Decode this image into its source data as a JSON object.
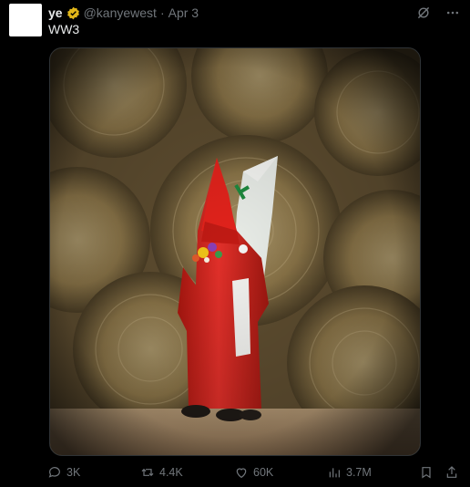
{
  "tweet": {
    "name": "ye",
    "handle": "@kanyewest",
    "separator": "·",
    "date": "Apr 3",
    "text": "WW3"
  },
  "actions": {
    "replies": "3K",
    "retweets": "4.4K",
    "likes": "60K",
    "views": "3.7M"
  },
  "icons": {
    "verified": "verified-badge-icon",
    "grok": "grok-icon",
    "more": "more-icon",
    "reply": "reply-icon",
    "retweet": "retweet-icon",
    "like": "heart-icon",
    "views": "views-icon",
    "bookmark": "bookmark-icon",
    "share": "share-icon"
  },
  "colors": {
    "background": "#000000",
    "text": "#e7e9ea",
    "muted": "#71767b",
    "verified_gold": "#e2b719",
    "robe_red": "#d8231f"
  }
}
